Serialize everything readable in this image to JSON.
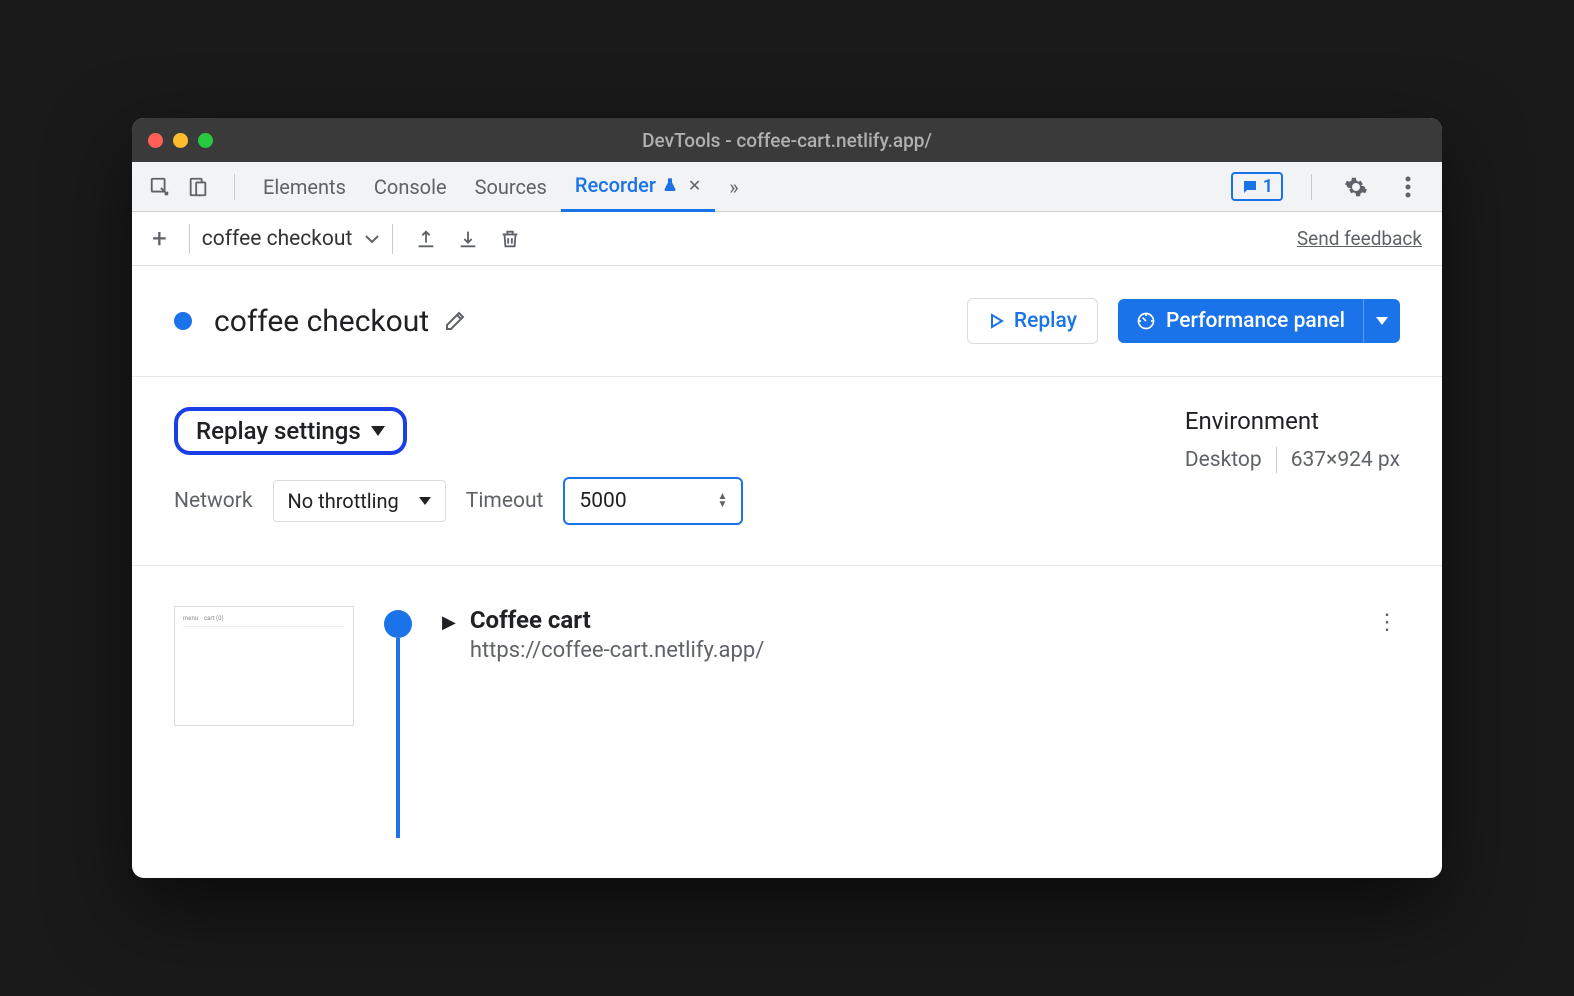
{
  "window": {
    "title": "DevTools - coffee-cart.netlify.app/"
  },
  "tabs": {
    "elements": "Elements",
    "console": "Console",
    "sources": "Sources",
    "recorder": "Recorder"
  },
  "issues_count": "1",
  "toolbar": {
    "recording_name": "coffee checkout",
    "feedback": "Send feedback"
  },
  "header": {
    "title": "coffee checkout",
    "replay_label": "Replay",
    "perf_label": "Performance panel"
  },
  "settings": {
    "replay_settings_label": "Replay settings",
    "network_label": "Network",
    "network_value": "No throttling",
    "timeout_label": "Timeout",
    "timeout_value": "5000",
    "environment_label": "Environment",
    "env_device": "Desktop",
    "env_viewport": "637×924 px"
  },
  "step": {
    "title": "Coffee cart",
    "url": "https://coffee-cart.netlify.app/"
  }
}
